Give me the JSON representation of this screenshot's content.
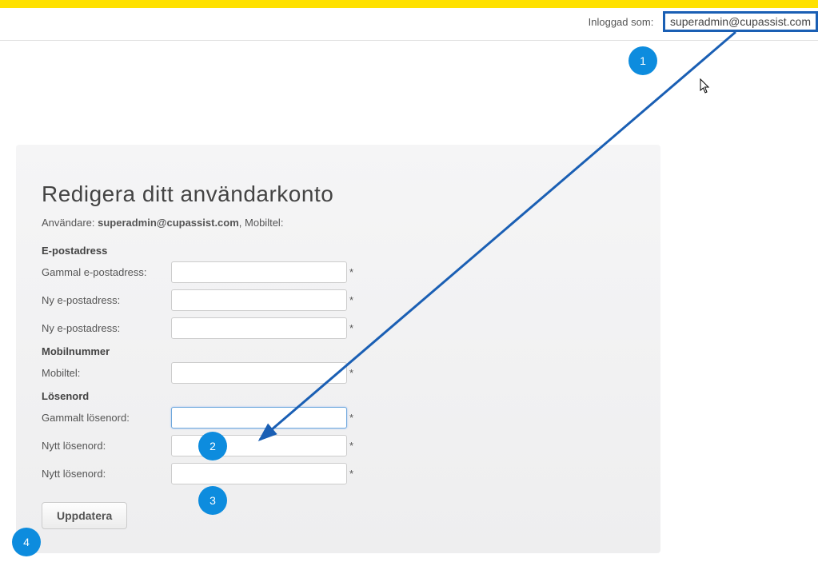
{
  "header": {
    "logged_in_label": "Inloggad som:",
    "user_email": "superadmin@cupassist.com"
  },
  "panel": {
    "title": "Redigera ditt användarkonto",
    "user_prefix": "Användare: ",
    "user_value": "superadmin@cupassist.com",
    "mobile_suffix": ", Mobiltel:",
    "sections": {
      "email_head": "E-postadress",
      "old_email_label": "Gammal e-postadress:",
      "new_email_label1": "Ny e-postadress:",
      "new_email_label2": "Ny e-postadress:",
      "mobile_head": "Mobilnummer",
      "mobile_label": "Mobiltel:",
      "password_head": "Lösenord",
      "old_pw_label": "Gammalt lösenord:",
      "new_pw_label1": "Nytt lösenord:",
      "new_pw_label2": "Nytt lösenord:"
    },
    "required_mark": "*",
    "button_label": "Uppdatera"
  },
  "annotations": {
    "b1": "1",
    "b2": "2",
    "b3": "3",
    "b4": "4"
  }
}
